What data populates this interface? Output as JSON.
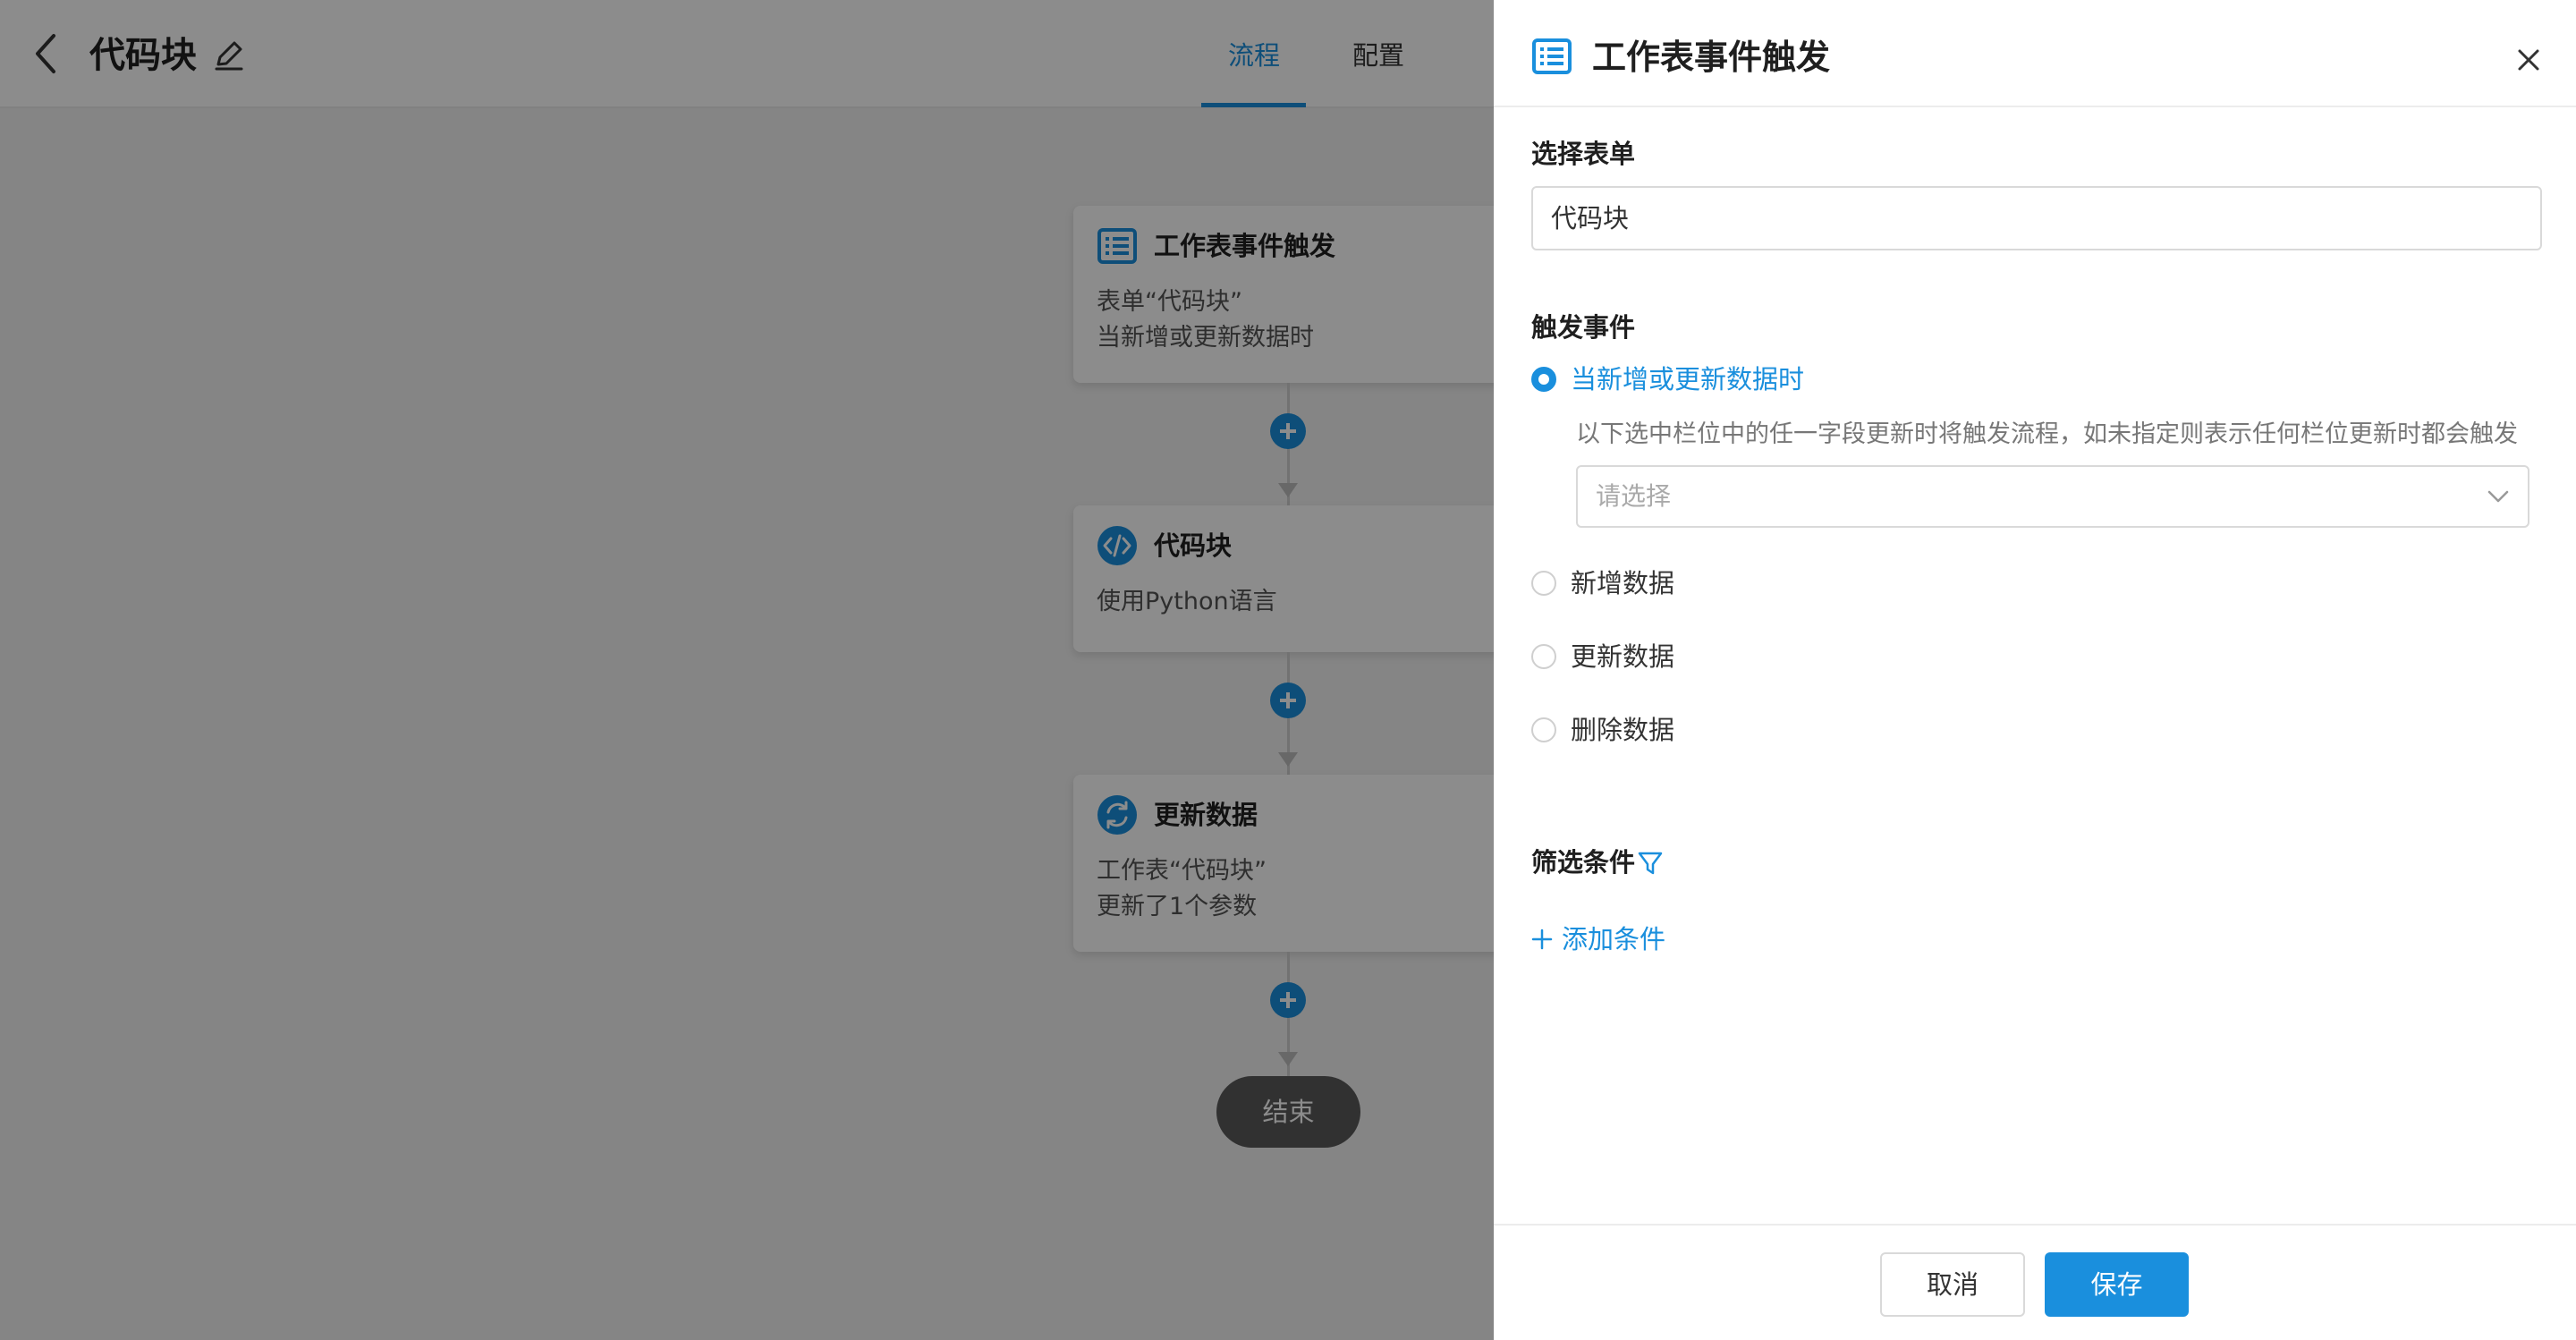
{
  "header": {
    "title": "代码块",
    "tabs": [
      {
        "label": "流程",
        "active": true
      },
      {
        "label": "配置",
        "active": false
      }
    ]
  },
  "flow": {
    "nodes": [
      {
        "icon": "table-list-icon",
        "title": "工作表事件触发",
        "lines": [
          "表单“代码块”",
          "当新增或更新数据时"
        ]
      },
      {
        "icon": "code-icon",
        "title": "代码块",
        "lines": [
          "使用Python语言"
        ]
      },
      {
        "icon": "refresh-icon",
        "title": "更新数据",
        "lines": [
          "工作表“代码块”",
          "更新了1个参数"
        ]
      }
    ],
    "end_label": "结束"
  },
  "drawer": {
    "title": "工作表事件触发",
    "select_form": {
      "label": "选择表单",
      "value": "代码块"
    },
    "trigger_event": {
      "label": "触发事件",
      "options": [
        {
          "label": "当新增或更新数据时",
          "checked": true
        },
        {
          "label": "新增数据",
          "checked": false
        },
        {
          "label": "更新数据",
          "checked": false
        },
        {
          "label": "删除数据",
          "checked": false
        }
      ],
      "hint": "以下选中栏位中的任一字段更新时将触发流程，如未指定则表示任何栏位更新时都会触发",
      "field_placeholder": "请选择"
    },
    "filter": {
      "label": "筛选条件",
      "add_label": "添加条件"
    },
    "footer": {
      "cancel_label": "取消",
      "save_label": "保存"
    }
  },
  "colors": {
    "accent": "#1a8fdd",
    "end_node": "#5a5a5a"
  }
}
